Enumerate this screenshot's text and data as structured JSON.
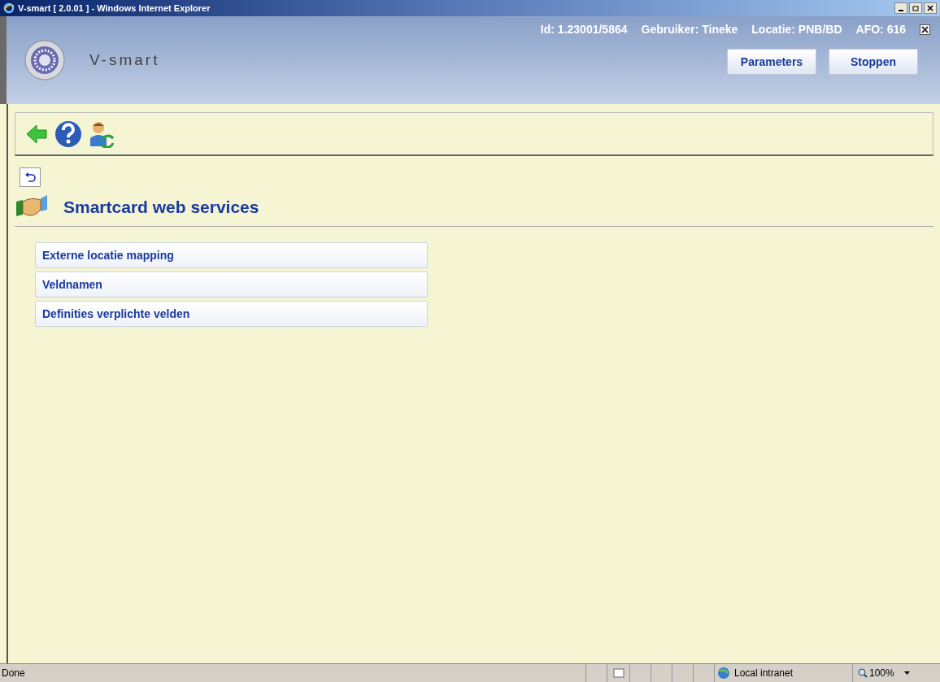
{
  "window": {
    "title": "V-smart [ 2.0.01 ] - Windows Internet Explorer"
  },
  "header": {
    "logo_text": "V-smart",
    "info": [
      "Id: 1.23001/5864",
      "Gebruiker: Tineke",
      "Locatie: PNB/BD",
      "AFO: 616"
    ],
    "buttons": [
      "Parameters",
      "Stoppen"
    ]
  },
  "page": {
    "title": "Smartcard web services",
    "menu": [
      "Externe locatie mapping",
      "Veldnamen",
      "Definities verplichte velden"
    ]
  },
  "status_bar": {
    "status": "Done",
    "zone": "Local intranet",
    "zoom": "100%"
  }
}
